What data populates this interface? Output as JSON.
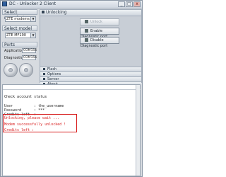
{
  "window": {
    "title": "DC - Unlocker 2 Client",
    "min": "_",
    "max": "□",
    "close": "x"
  },
  "left": {
    "manufacturer": {
      "label": "Select manufacturer",
      "value": "ZTE modems"
    },
    "model": {
      "label": "Select model",
      "value": "ZTE MF190"
    },
    "ports": {
      "label": "Ports",
      "application_label": "Application",
      "application_value": "COM156",
      "diagnostic_label": "Diagnostic",
      "diagnostic_value": "COM156"
    }
  },
  "unlocking": {
    "header": "Unlocking",
    "buttons": [
      "Unlock",
      "Enable Diagnostic port",
      "Disable Diagnostic port"
    ]
  },
  "sections": [
    "Flash",
    "Options",
    "Server",
    "About"
  ],
  "log": {
    "lines": [
      "Check account status",
      "",
      "User          : the_username",
      "Password      : ***",
      "Credits left  :",
      "",
      "Unlocking, please wait ...",
      "",
      "Modem successfully unlocked !",
      "",
      "Credits left :"
    ]
  },
  "colors": {
    "highlight": "#d82020"
  }
}
